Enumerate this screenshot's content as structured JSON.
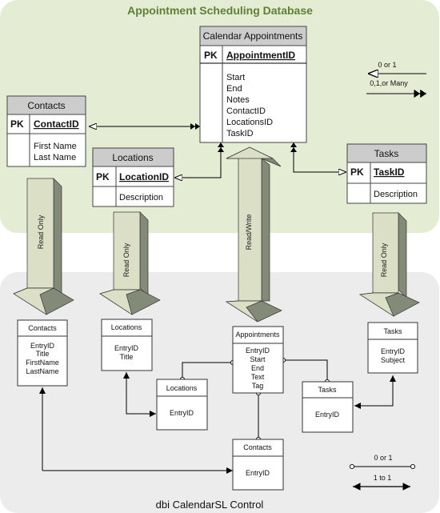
{
  "database": {
    "title": "Appointment Scheduling Database",
    "tables": {
      "calendar_appointments": {
        "name": "Calendar Appointments",
        "pk_label": "PK",
        "pk": "AppointmentID",
        "fields": [
          "Start",
          "End",
          "Notes",
          "ContactID",
          "LocationsID",
          "TaskID"
        ]
      },
      "contacts": {
        "name": "Contacts",
        "pk_label": "PK",
        "pk": "ContactID",
        "fields": [
          "First Name",
          "Last Name"
        ]
      },
      "locations": {
        "name": "Locations",
        "pk_label": "PK",
        "pk": "LocationID",
        "fields": [
          "Description"
        ]
      },
      "tasks": {
        "name": "Tasks",
        "pk_label": "PK",
        "pk": "TaskID",
        "fields": [
          "Description"
        ]
      }
    },
    "legend": {
      "zero_or_one": "0 or 1",
      "zero_one_many": "0,1,or Many"
    }
  },
  "arrows": {
    "contacts": "Read Only",
    "locations": "Read Only",
    "appointments": "Read/Write",
    "tasks": "Read Only"
  },
  "control": {
    "title": "dbi CalendarSL Control",
    "entities": {
      "contacts_top": {
        "name": "Contacts",
        "fields": [
          "EntryID",
          "Title",
          "FirstName",
          "LastName"
        ]
      },
      "locations_top": {
        "name": "Locations",
        "fields": [
          "EntryID",
          "Title"
        ]
      },
      "appointments": {
        "name": "Appointments",
        "fields": [
          "EntryID",
          "Start",
          "End",
          "Text",
          "Tag"
        ]
      },
      "tasks_top": {
        "name": "Tasks",
        "fields": [
          "EntryID",
          "Subject"
        ]
      },
      "locations_link": {
        "name": "Locations",
        "fields": [
          "EntryID"
        ]
      },
      "tasks_link": {
        "name": "Tasks",
        "fields": [
          "EntryID"
        ]
      },
      "contacts_link": {
        "name": "Contacts",
        "fields": [
          "EntryID"
        ]
      }
    },
    "legend": {
      "zero_or_one": "0 or 1",
      "one_to_one": "1 to 1"
    }
  },
  "colors": {
    "db_panel": "#e5ecd4",
    "control_panel": "#ececec",
    "title_green": "#5f7f35",
    "header_grey": "#cccccc",
    "arrow_face": "#dadfc6",
    "arrow_shadow": "#848a78"
  }
}
